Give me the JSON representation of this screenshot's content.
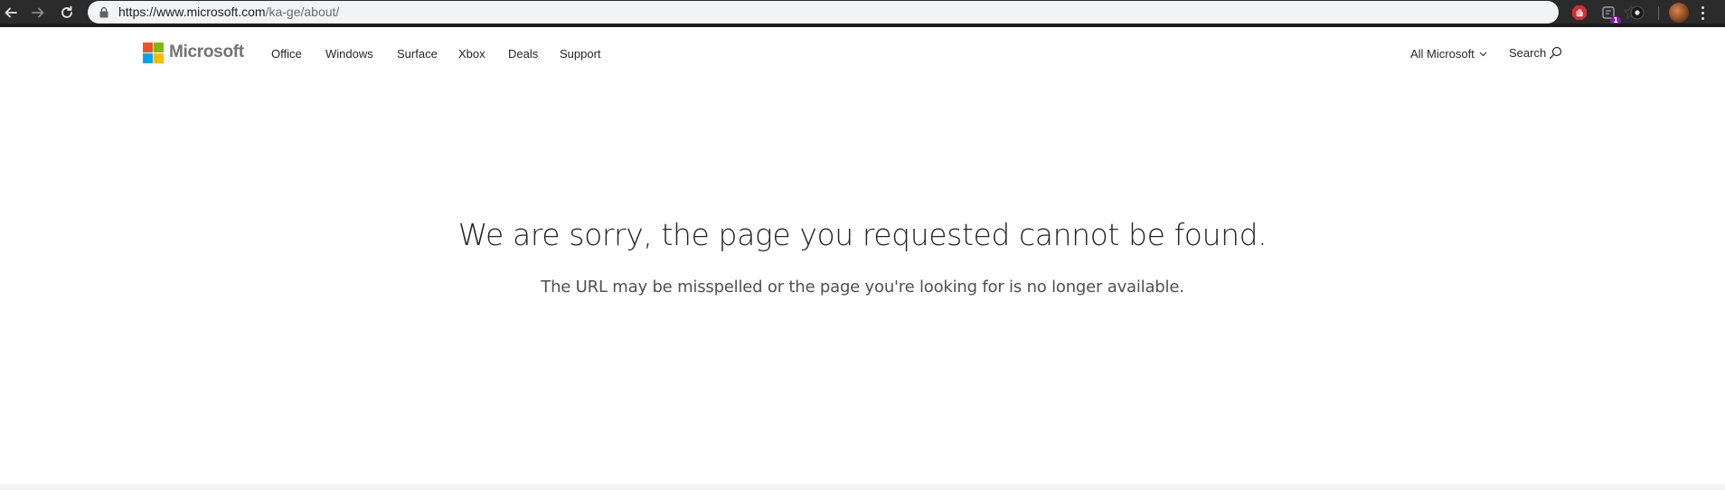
{
  "browser": {
    "url_host": "https://www.microsoft.com",
    "url_path": "/ka-ge/about/",
    "extensions": [
      {
        "name": "adblock-icon",
        "badge": ""
      },
      {
        "name": "extension-icon",
        "badge": "1"
      },
      {
        "name": "record-icon",
        "badge": ""
      }
    ]
  },
  "header": {
    "brand": "Microsoft",
    "nav": [
      "Office",
      "Windows",
      "Surface",
      "Xbox",
      "Deals",
      "Support"
    ],
    "all_microsoft": "All Microsoft",
    "search": "Search"
  },
  "error": {
    "title": "We are sorry, the page you requested cannot be found.",
    "subtitle": "The URL may be misspelled or the page you're looking for is no longer available."
  },
  "colors": {
    "logo_red": "#f25022",
    "logo_green": "#7fba00",
    "logo_blue": "#00a4ef",
    "logo_yellow": "#ffb900"
  }
}
